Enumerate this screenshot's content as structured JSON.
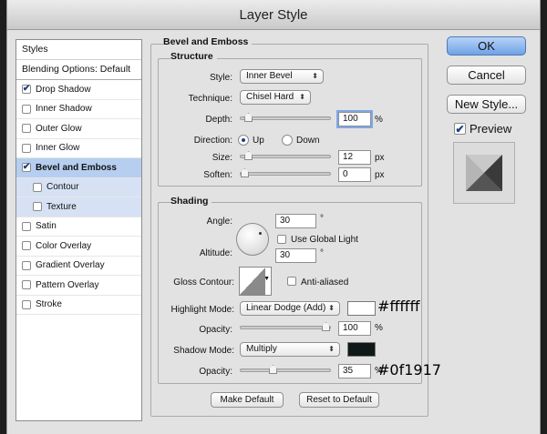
{
  "window": {
    "title": "Layer Style"
  },
  "left_panel": {
    "styles_label": "Styles",
    "blending_label": "Blending Options: Default",
    "items": [
      {
        "label": "Drop Shadow",
        "checked": true
      },
      {
        "label": "Inner Shadow",
        "checked": false
      },
      {
        "label": "Outer Glow",
        "checked": false
      },
      {
        "label": "Inner Glow",
        "checked": false
      },
      {
        "label": "Bevel and Emboss",
        "checked": true,
        "selected": true
      },
      {
        "label": "Contour",
        "checked": false,
        "sub": true
      },
      {
        "label": "Texture",
        "checked": false,
        "sub": true
      },
      {
        "label": "Satin",
        "checked": false
      },
      {
        "label": "Color Overlay",
        "checked": false
      },
      {
        "label": "Gradient Overlay",
        "checked": false
      },
      {
        "label": "Pattern Overlay",
        "checked": false
      },
      {
        "label": "Stroke",
        "checked": false
      }
    ]
  },
  "bevel": {
    "section_title": "Bevel and Emboss",
    "structure": {
      "title": "Structure",
      "style_label": "Style:",
      "style_value": "Inner Bevel",
      "technique_label": "Technique:",
      "technique_value": "Chisel Hard",
      "depth_label": "Depth:",
      "depth_value": "100",
      "depth_unit": "%",
      "depth_level": 0.05,
      "direction_label": "Direction:",
      "direction_up": "Up",
      "direction_down": "Down",
      "size_label": "Size:",
      "size_value": "12",
      "size_unit": "px",
      "size_level": 0.05,
      "soften_label": "Soften:",
      "soften_value": "0",
      "soften_unit": "px",
      "soften_level": 0.0
    },
    "shading": {
      "title": "Shading",
      "angle_label": "Angle:",
      "angle_value": "30",
      "angle_unit": "°",
      "global_light_label": "Use Global Light",
      "altitude_label": "Altitude:",
      "altitude_value": "30",
      "altitude_unit": "°",
      "gloss_label": "Gloss Contour:",
      "anti_aliased_label": "Anti-aliased",
      "highlight_label": "Highlight Mode:",
      "highlight_value": "Linear Dodge (Add)",
      "highlight_color": "#ffffff",
      "highlight_annot": "#ffffff",
      "opacity_label": "Opacity:",
      "opacity1_value": "100",
      "opacity1_unit": "%",
      "opacity1_level": 1.0,
      "shadow_label": "Shadow Mode:",
      "shadow_value": "Multiply",
      "shadow_color": "#0f1917",
      "shadow_annot": "#0f1917",
      "opacity2_label": "Opacity:",
      "opacity2_value": "35",
      "opacity2_unit": "%",
      "opacity2_level": 0.35
    },
    "make_default": "Make Default",
    "reset_default": "Reset to Default"
  },
  "buttons": {
    "ok": "OK",
    "cancel": "Cancel",
    "new_style": "New Style...",
    "preview_label": "Preview"
  }
}
